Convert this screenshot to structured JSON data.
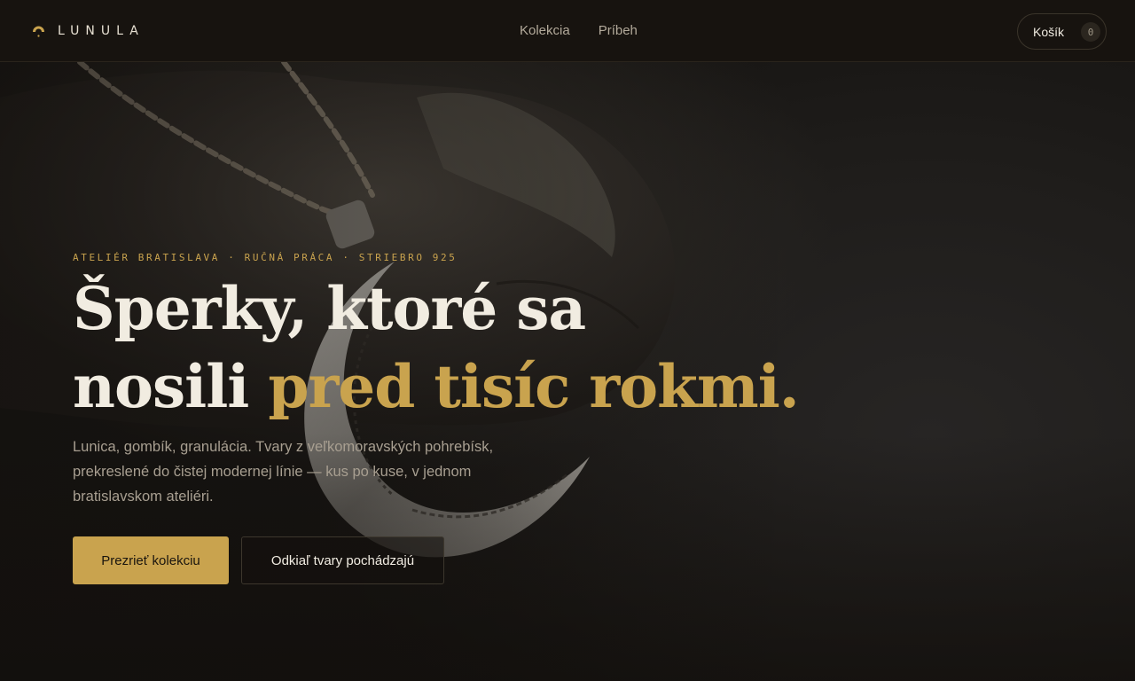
{
  "brand": {
    "name": "LUNULA",
    "icon": "crescent-moon-icon",
    "accent": "#c9a34e"
  },
  "nav": {
    "items": [
      {
        "label": "Kolekcia"
      },
      {
        "label": "Príbeh"
      }
    ]
  },
  "cart": {
    "label": "Košík",
    "count": "0"
  },
  "hero": {
    "eyebrow": "ATELIÉR BRATISLAVA · RUČNÁ PRÁCA · STRIEBRO 925",
    "headline_line1": "Šperky, ktoré sa",
    "headline_line2_plain": "nosili ",
    "headline_line2_accent": "pred tisíc rokmi.",
    "lede": "Lunica, gombík, granulácia. Tvary z veľkomoravských pohrebísk, prekreslené do čistej modernej línie — kus po kuse, v jednom bratislavskom ateliéri.",
    "primary_cta": "Prezrieť kolekciu",
    "secondary_cta": "Odkiaľ tvary pochádzajú"
  }
}
